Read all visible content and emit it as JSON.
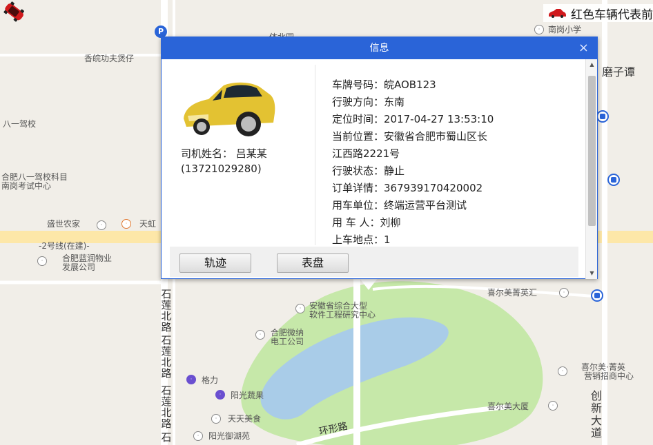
{
  "legend": {
    "text": "红色车辆代表前",
    "icon": "red-car-icon"
  },
  "map": {
    "labels": {
      "hamburger": "香皖功夫煲仔",
      "bayi_school": "八一驾校",
      "bayi_school2_line1": "合肥八一驾校科目",
      "bayi_school2_line2": "南岗考试中心",
      "nangang_primary": "南岗小学",
      "mozi": "磨子谭",
      "shengshi": "盛世农家",
      "tianhong": "天虹",
      "line2": "-2号线(在建)-",
      "lanrun_line1": "合肥蓝润物业",
      "lanrun_line2": "发展公司",
      "anhui_line1": "安徽省综合大型",
      "anhui_line2": "软件工程研究中心",
      "weina_line1": "合肥微纳",
      "weina_line2": "电工公司",
      "xierm_huijing": "喜尔美菁英汇",
      "xierm_jingying_line1": "喜尔美·菁英",
      "xierm_jingying_line2": "营销招商中心",
      "gree": "格力",
      "yangguang_shucai": "阳光蔬果",
      "tiantian": "天天美食",
      "yangguang_yuhu": "阳光御湖苑",
      "xierm_dasha": "喜尔美大厦",
      "huanxing_road": "环形路",
      "jiangbei": "体北园",
      "shilian_road_1": "石莲北路",
      "shilian_road_2": "石莲北路",
      "shilian_road_3": "石莲北路",
      "shilian_road_4": "石",
      "chuangxin_road": "创新大道"
    }
  },
  "dialog": {
    "title": "信息",
    "close_label": "×",
    "driver_name": "司机姓名： 吕某某",
    "driver_phone": "(13721029280)",
    "info": [
      "车牌号码：皖AOB123",
      "行驶方向：东南",
      "定位时间：2017-04-27 13:53:10",
      "当前位置：安徽省合肥市蜀山区长",
      "江西路2221号",
      "行驶状态：静止",
      "订单详情：367939170420002",
      "用车单位：终端运营平台测试",
      "用 车 人：刘柳",
      "上车地点：1"
    ],
    "buttons": {
      "track": "轨迹",
      "dashboard": "表盘"
    }
  },
  "colors": {
    "accent": "#2a64d8",
    "vehicle": "#d0191c",
    "lake": "#a9cce8",
    "park": "#c6e8a9"
  }
}
